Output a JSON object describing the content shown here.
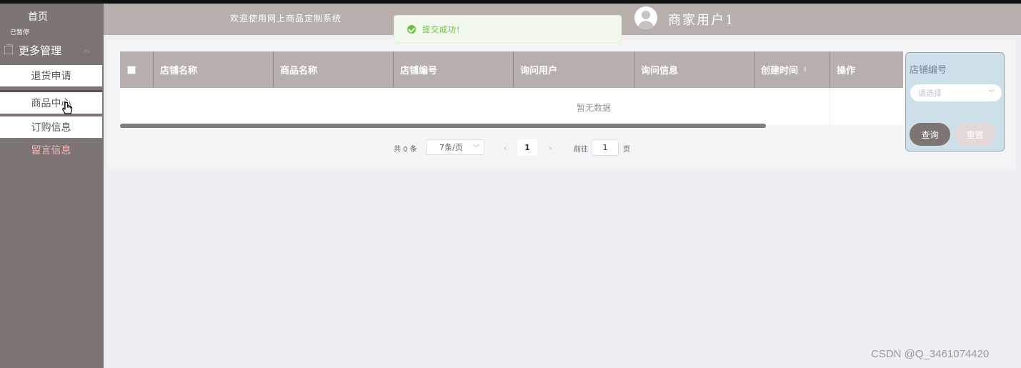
{
  "sidebar": {
    "home_label": "首页",
    "paused_label": "已暂停",
    "group_label": "更多管理",
    "items": [
      {
        "label": "退货申请"
      },
      {
        "label": "商品中心"
      },
      {
        "label": "订购信息"
      },
      {
        "label": "留言信息"
      }
    ]
  },
  "header": {
    "welcome": "欢迎使用网上商品定制系统",
    "username": "商家用户1"
  },
  "toast": {
    "message": "提交成功!"
  },
  "table": {
    "columns": [
      "店铺名称",
      "商品名称",
      "店铺编号",
      "询问用户",
      "询问信息",
      "创建时间",
      "操作"
    ],
    "empty_text": "暂无数据"
  },
  "pagination": {
    "total_text": "共 0 条",
    "page_size": "7条/页",
    "current_page": "1",
    "goto_label": "前往",
    "goto_value": "1",
    "page_unit": "页"
  },
  "filter": {
    "label": "店铺编号",
    "select_placeholder": "请选择",
    "query_label": "查询",
    "reset_label": "重置"
  },
  "watermark": "CSDN @Q_3461074420"
}
